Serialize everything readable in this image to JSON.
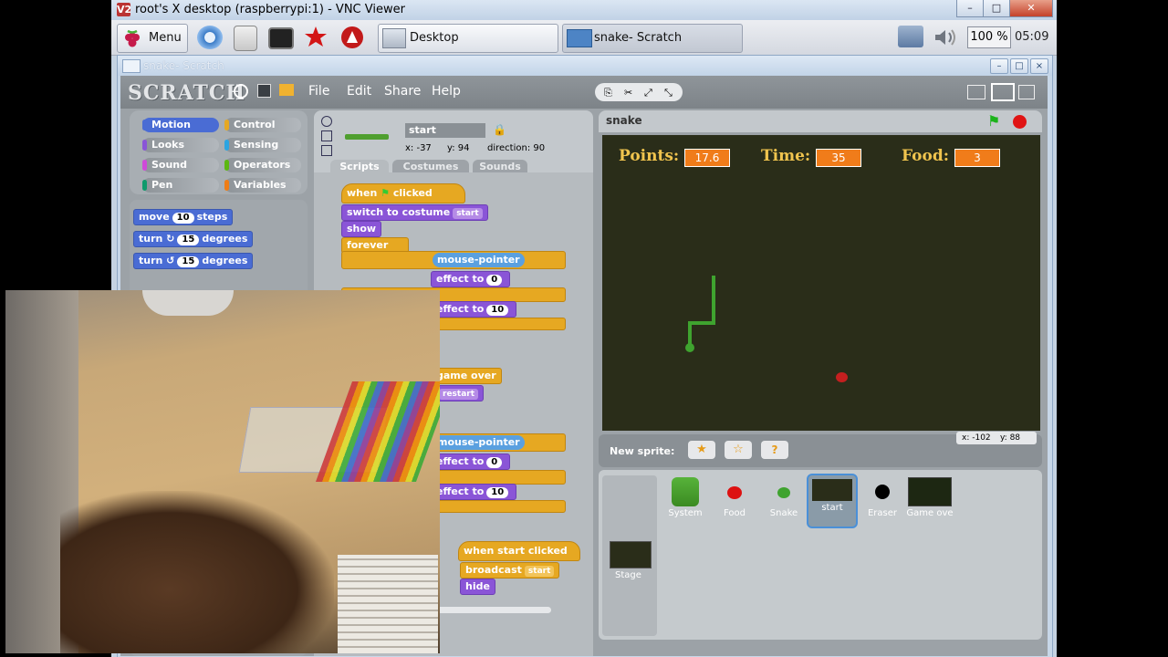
{
  "vnc": {
    "title": "root's X desktop (raspberrypi:1) - VNC Viewer",
    "logo": "V2"
  },
  "panel": {
    "menu_label": "Menu",
    "tasks": [
      {
        "label": "Desktop"
      },
      {
        "label": "snake- Scratch"
      }
    ],
    "volume_pct": "100 %",
    "clock": "05:09"
  },
  "scratch_window": {
    "title": "snake- Scratch"
  },
  "scratch": {
    "logo": "SCRATCH",
    "menus": [
      "File",
      "Edit",
      "Share",
      "Help"
    ],
    "categories": [
      {
        "label": "Motion",
        "color": "#4a6cd4"
      },
      {
        "label": "Control",
        "color": "#e6a822"
      },
      {
        "label": "Looks",
        "color": "#8a55d7"
      },
      {
        "label": "Sensing",
        "color": "#2ca5e2"
      },
      {
        "label": "Sound",
        "color": "#cf4ad9"
      },
      {
        "label": "Operators",
        "color": "#5cb712"
      },
      {
        "label": "Pen",
        "color": "#0e9a6c"
      },
      {
        "label": "Variables",
        "color": "#ee7d16"
      }
    ],
    "palette": [
      {
        "pre": "move",
        "num": "10",
        "post": "steps"
      },
      {
        "pre": "turn ↻",
        "num": "15",
        "post": "degrees"
      },
      {
        "pre": "turn ↺",
        "num": "15",
        "post": "degrees"
      }
    ],
    "sprite": {
      "name": "start",
      "x": "x: -37",
      "y": "y: 94",
      "direction": "direction: 90"
    },
    "tabs": [
      "Scripts",
      "Costumes",
      "Sounds"
    ],
    "scripts": {
      "when_flag_a": "when",
      "when_flag_b": "clicked",
      "switch_costume": "switch to costume",
      "costume_val": "start",
      "show": "show",
      "forever": "forever",
      "touching_1": "mouse-pointer",
      "effect_1": "effect to",
      "effect_1_val": "0",
      "effect_2": "effect to",
      "effect_2_val": "10",
      "broadcast_val": "game over",
      "costume_2_val": "restart",
      "touching_2": "mouse-pointer",
      "effect_3": "effect to",
      "effect_3_val": "0",
      "effect_4": "effect to",
      "effect_4_val": "10",
      "hat_2": "when start clicked",
      "broadcast": "broadcast",
      "broadcast_2_val": "start",
      "hide": "hide"
    },
    "stage": {
      "title": "snake",
      "points_label": "Points:",
      "points": "17.6",
      "time_label": "Time:",
      "time": "35",
      "food_label": "Food:",
      "food": "3",
      "mouse_x": "x: -102",
      "mouse_y": "y: 88"
    },
    "new_sprite_label": "New sprite:",
    "sprites": [
      {
        "label": "System"
      },
      {
        "label": "Food"
      },
      {
        "label": "Snake"
      },
      {
        "label": "start"
      },
      {
        "label": "Eraser"
      },
      {
        "label": "Game ove"
      }
    ],
    "stage_thumb_label": "Stage"
  }
}
